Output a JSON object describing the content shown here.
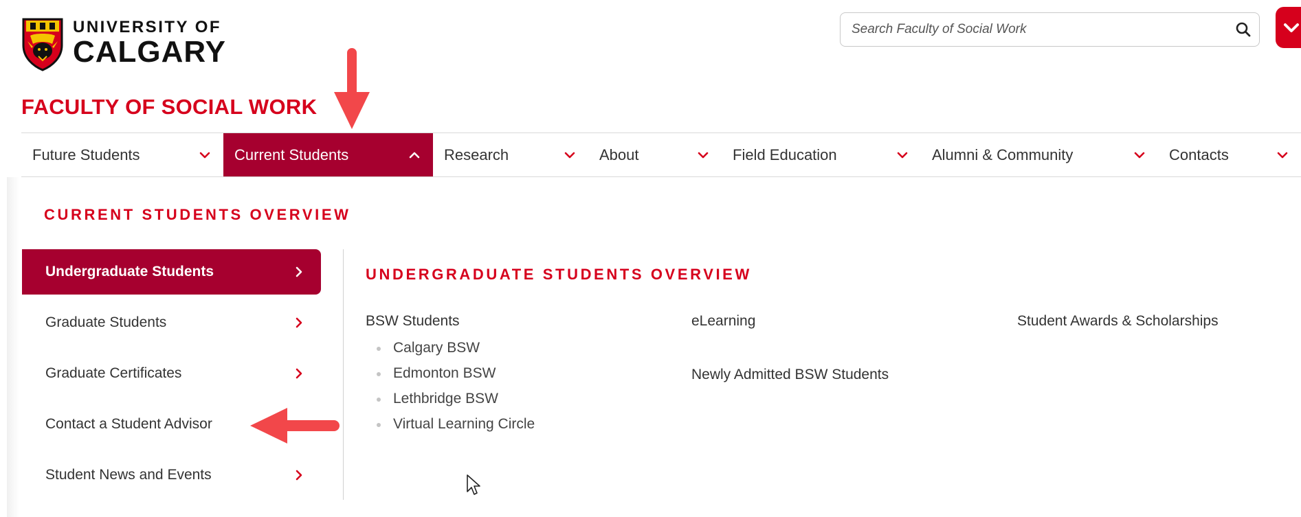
{
  "header": {
    "logo_line1": "UNIVERSITY OF",
    "logo_line2": "CALGARY",
    "search_placeholder": "Search Faculty of Social Work",
    "faculty_title": "FACULTY OF SOCIAL WORK"
  },
  "nav": {
    "items": [
      {
        "label": "Future Students"
      },
      {
        "label": "Current Students"
      },
      {
        "label": "Research"
      },
      {
        "label": "About"
      },
      {
        "label": "Field Education"
      },
      {
        "label": "Alumni & Community"
      },
      {
        "label": "Contacts"
      }
    ]
  },
  "mega_menu": {
    "overview_label": "CURRENT STUDENTS OVERVIEW",
    "side_items": [
      {
        "label": "Undergraduate Students"
      },
      {
        "label": "Graduate Students"
      },
      {
        "label": "Graduate Certificates"
      },
      {
        "label": "Contact a Student Advisor"
      },
      {
        "label": "Student News and Events"
      }
    ],
    "sub_overview_label": "UNDERGRADUATE STUDENTS OVERVIEW",
    "columns": [
      {
        "heading": "BSW Students",
        "children": [
          "Calgary BSW",
          "Edmonton BSW",
          "Lethbridge BSW",
          "Virtual Learning Circle"
        ]
      },
      {
        "headings": [
          "eLearning",
          "Newly Admitted BSW Students"
        ]
      },
      {
        "heading": "Student Awards & Scholarships"
      }
    ]
  },
  "colors": {
    "brand_red": "#d6001c",
    "active_bg": "#a6002f",
    "annotation_arrow": "#f2474a",
    "crest_gold": "#f5c400"
  }
}
